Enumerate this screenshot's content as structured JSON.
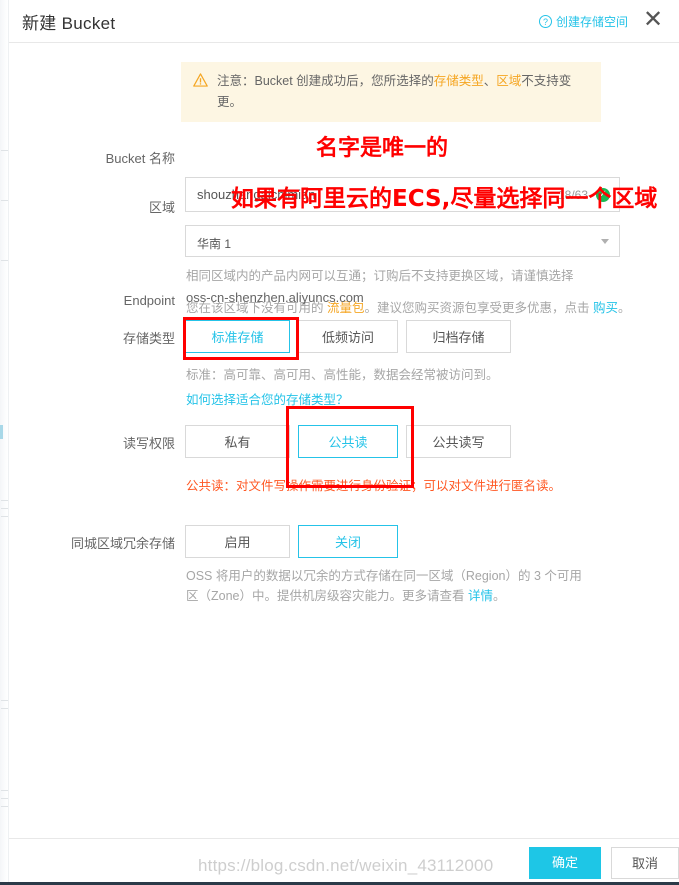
{
  "header": {
    "title": "新建 Bucket",
    "help_link": "创建存储空间",
    "help_icon": "question-circle-icon",
    "close_icon": "close-icon"
  },
  "notice": {
    "icon": "warning-triangle-icon",
    "prefix": "注意：Bucket 创建成功后，您所选择的",
    "highlight1": "存储类型",
    "separator": "、",
    "highlight2": "区域",
    "suffix": "不支持变更。"
  },
  "form": {
    "bucket_name": {
      "label": "Bucket 名称",
      "value": "shouzhangaichimian",
      "counter": "18/63",
      "check_icon": "check-circle-icon"
    },
    "region": {
      "label": "区域",
      "value": "华南 1",
      "arrow_icon": "chevron-down-icon",
      "hint1": "相同区域内的产品内网可以互通；订购后不支持更换区域，请谨慎选择",
      "hint2_a": "您在该区域下没有可用的 ",
      "hint2_pkg": "流量包",
      "hint2_b": "。建议您购买资源包享受更多优惠，点击 ",
      "hint2_buy": "购买",
      "hint2_c": "。"
    },
    "endpoint": {
      "label": "Endpoint",
      "value": "oss-cn-shenzhen.aliyuncs.com"
    },
    "storage_class": {
      "label": "存储类型",
      "options": [
        {
          "label": "标准存储",
          "selected": true
        },
        {
          "label": "低频访问",
          "selected": false
        },
        {
          "label": "归档存储",
          "selected": false
        }
      ],
      "desc": "标准：高可靠、高可用、高性能，数据会经常被访问到。",
      "link": "如何选择适合您的存储类型？"
    },
    "acl": {
      "label": "读写权限",
      "options": [
        {
          "label": "私有",
          "selected": false
        },
        {
          "label": "公共读",
          "selected": true
        },
        {
          "label": "公共读写",
          "selected": false
        }
      ],
      "warning": "公共读：对文件写操作需要进行身份验证；可以对文件进行匿名读。"
    },
    "redundancy": {
      "label": "同城区域冗余存储",
      "options": [
        {
          "label": "启用",
          "selected": false
        },
        {
          "label": "关闭",
          "selected": true
        }
      ],
      "desc_a": "OSS 将用户的数据以冗余的方式存储在同一区域（Region）的 3 个可用区（Zone）中。提供机房级容灾能力。更多请查看 ",
      "desc_link": "详情",
      "desc_b": "。"
    }
  },
  "footer": {
    "ok_label": "确定",
    "cancel_label": "取消"
  },
  "annotations": [
    {
      "text": "名字是唯一的"
    },
    {
      "text": "如果有阿里云的ECS,尽量选择同一个区域"
    }
  ],
  "watermark": "https://blog.csdn.net/weixin_43112000",
  "colors": {
    "accent": "#25c3e8",
    "notice_bg": "#fdf6e3",
    "notice_highlight": "#f5a623",
    "annotation_red": "#ff0000",
    "warning_red": "#ff5722",
    "success_green": "#19b955",
    "primary_button": "#1ec6e6"
  }
}
